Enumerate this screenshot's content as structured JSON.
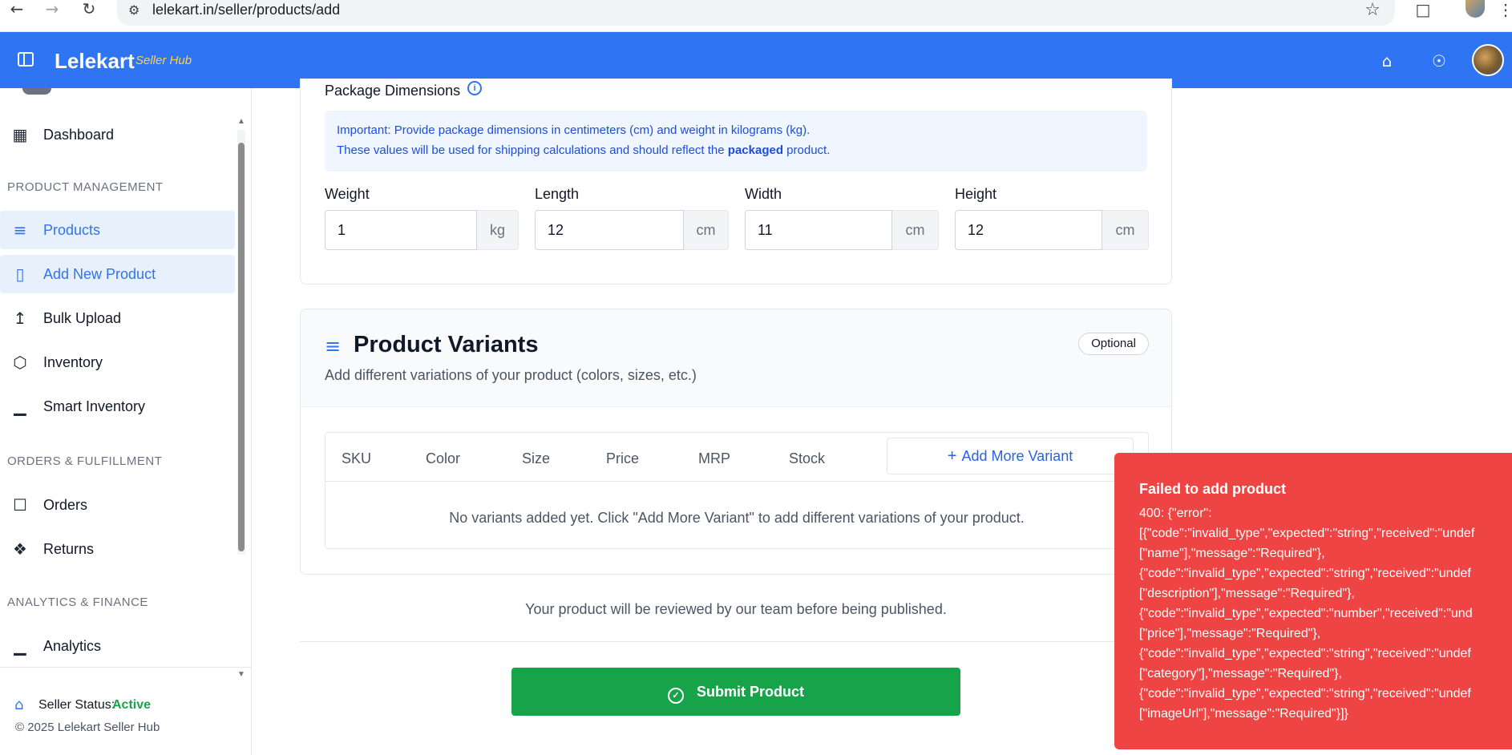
{
  "browser": {
    "url": "lelekart.in/seller/products/add"
  },
  "header": {
    "brand": "Lelekart",
    "brand_sub": "Seller Hub"
  },
  "sidebar": {
    "items": [
      {
        "label": "Dashboard",
        "icon": "grid-icon"
      },
      {
        "label": "Products",
        "icon": "layers-icon"
      },
      {
        "label": "Add New Product",
        "icon": "bookmark-icon"
      },
      {
        "label": "Bulk Upload",
        "icon": "upload-icon"
      },
      {
        "label": "Inventory",
        "icon": "box-icon"
      },
      {
        "label": "Smart Inventory",
        "icon": "bar-chart-icon"
      },
      {
        "label": "Orders",
        "icon": "bag-icon"
      },
      {
        "label": "Returns",
        "icon": "boxes-icon"
      },
      {
        "label": "Analytics",
        "icon": "bar-chart-icon"
      }
    ],
    "sections": {
      "product_management": "PRODUCT MANAGEMENT",
      "orders": "ORDERS & FULFILLMENT",
      "analytics": "ANALYTICS & FINANCE"
    },
    "footer": {
      "status_label": "Seller Status:",
      "status_value": "Active",
      "copyright": "© 2025 Lelekart Seller Hub"
    }
  },
  "package": {
    "title": "Package Dimensions",
    "notice_line1": "Important: Provide package dimensions in centimeters (cm) and weight in kilograms (kg).",
    "notice_line2_pre": "These values will be used for shipping calculations and should reflect the",
    "notice_line2_bold": "packaged",
    "notice_line2_post": "product.",
    "fields": [
      {
        "label": "Weight",
        "value": "1",
        "unit": "kg"
      },
      {
        "label": "Length",
        "value": "12",
        "unit": "cm"
      },
      {
        "label": "Width",
        "value": "11",
        "unit": "cm"
      },
      {
        "label": "Height",
        "value": "12",
        "unit": "cm"
      }
    ]
  },
  "variants": {
    "title": "Product Variants",
    "subtitle": "Add different variations of your product (colors, sizes, etc.)",
    "badge": "Optional",
    "columns": [
      "SKU",
      "Color",
      "Size",
      "Price",
      "MRP",
      "Stock"
    ],
    "add_button": "Add More Variant",
    "empty_message": "No variants added yet. Click \"Add More Variant\" to add different variations of your product."
  },
  "review_note": "Your product will be reviewed by our team before being published.",
  "submit_label": "Submit Product",
  "toast": {
    "title": "Failed to add product",
    "body": "400: {\"error\":\n[{\"code\":\"invalid_type\",\"expected\":\"string\",\"received\":\"undef\n[\"name\"],\"message\":\"Required\"},\n{\"code\":\"invalid_type\",\"expected\":\"string\",\"received\":\"undef\n[\"description\"],\"message\":\"Required\"},\n{\"code\":\"invalid_type\",\"expected\":\"number\",\"received\":\"und\n[\"price\"],\"message\":\"Required\"},\n{\"code\":\"invalid_type\",\"expected\":\"string\",\"received\":\"undef\n[\"category\"],\"message\":\"Required\"},\n{\"code\":\"invalid_type\",\"expected\":\"string\",\"received\":\"undef\n[\"imageUrl\"],\"message\":\"Required\"}]}"
  },
  "colors": {
    "brand": "#2f74f2",
    "success": "#16a34a",
    "error": "#ef4444"
  }
}
